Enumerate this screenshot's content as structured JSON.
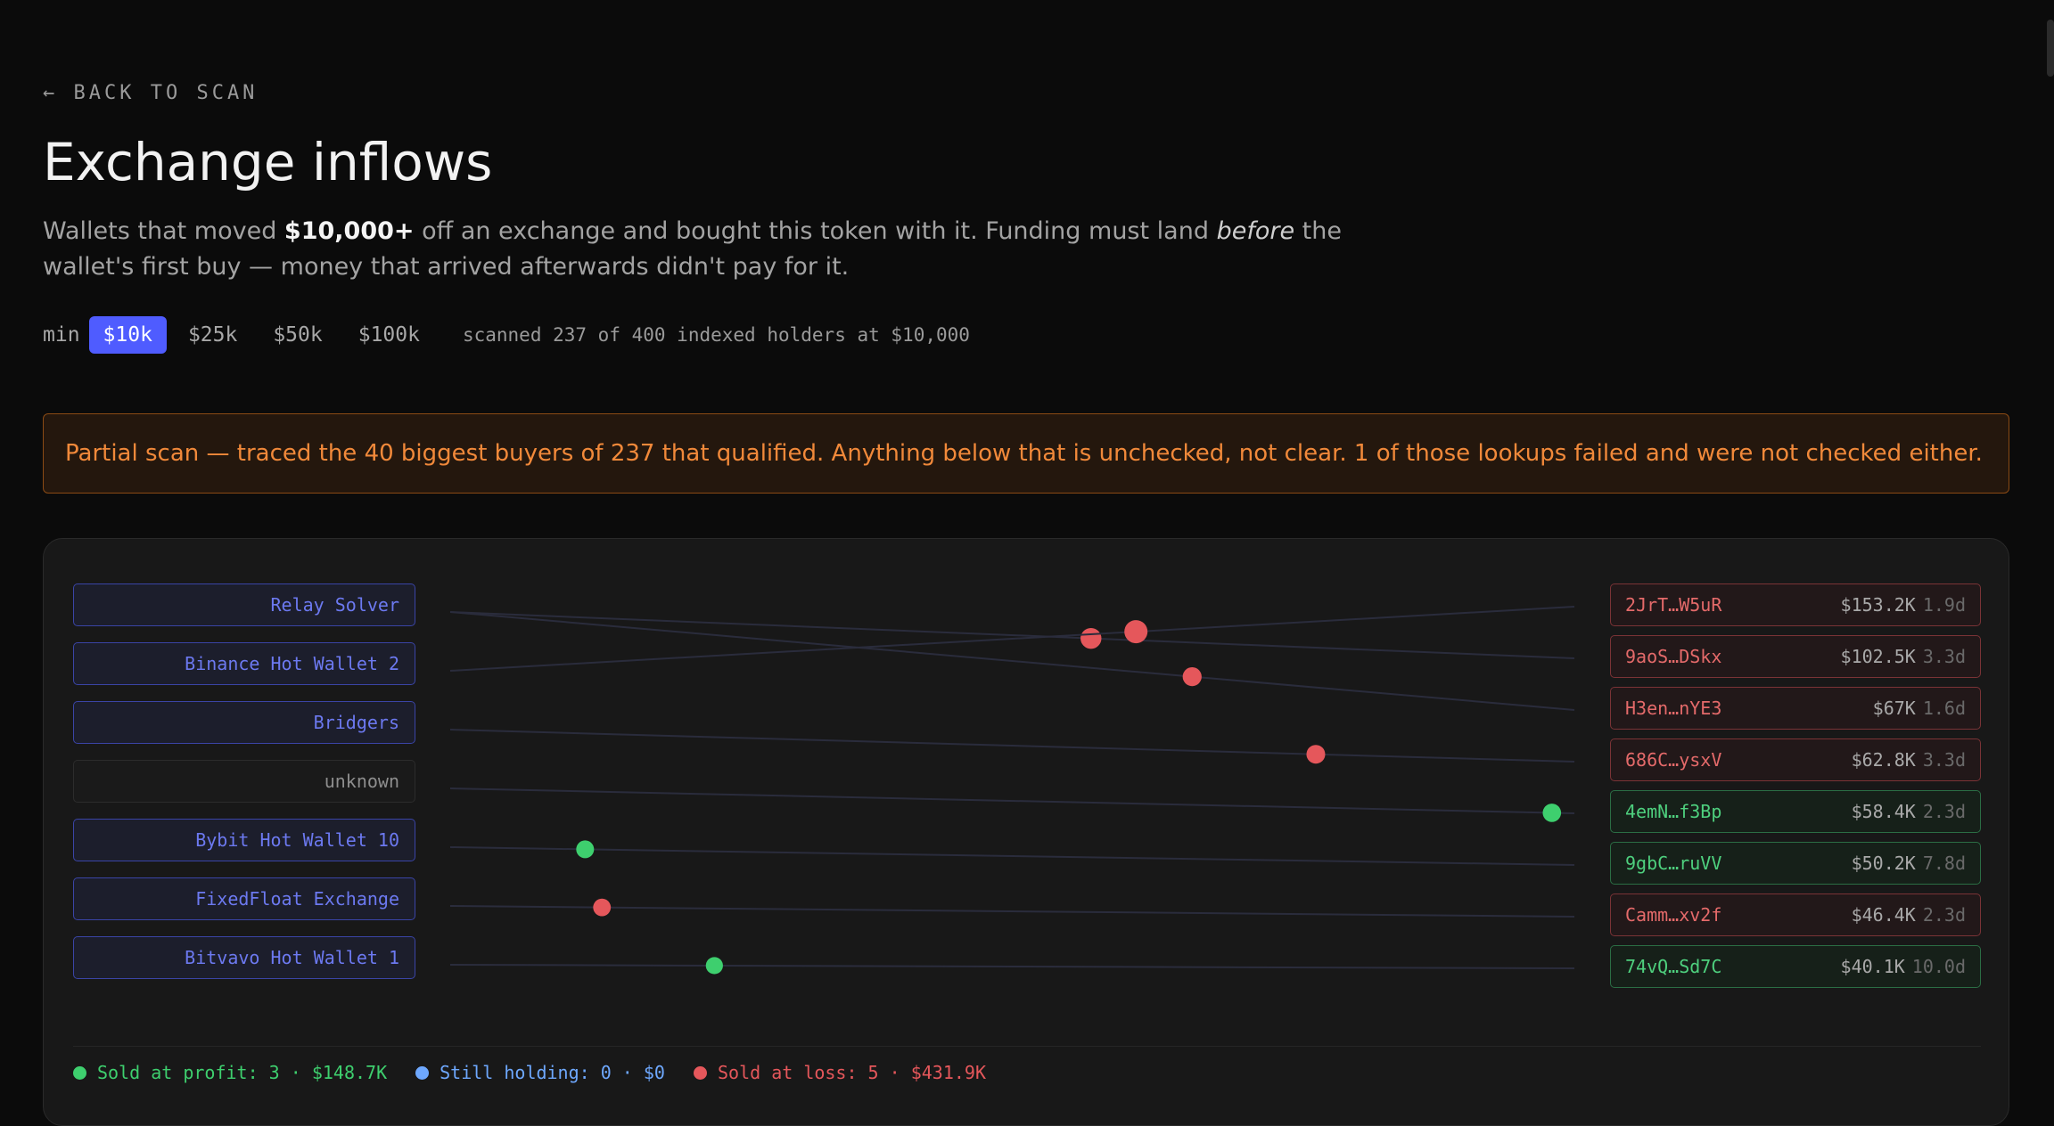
{
  "nav": {
    "back_label": "← BACK TO SCAN"
  },
  "page": {
    "title": "Exchange inflows",
    "desc_1": "Wallets that moved ",
    "desc_bold": "$10,000+",
    "desc_2": " off an exchange and bought this token with it. Funding must land ",
    "desc_italic": "before",
    "desc_3": " the wallet's first buy — money that arrived afterwards didn't pay for it."
  },
  "filters": {
    "label": "min",
    "options": [
      "$10k",
      "$25k",
      "$50k",
      "$100k"
    ],
    "active": "$10k",
    "scan_info": "scanned 237 of 400 indexed holders at $10,000"
  },
  "banner": {
    "text": "Partial scan — traced the 40 biggest buyers of 237 that qualified. Anything below that is unchecked, not clear. 1 of those lookups failed and were not checked either."
  },
  "sources": [
    {
      "label": "Relay Solver",
      "known": true
    },
    {
      "label": "Binance Hot Wallet 2",
      "known": true
    },
    {
      "label": "Bridgers",
      "known": true
    },
    {
      "label": "unknown",
      "known": false
    },
    {
      "label": "Bybit Hot Wallet 10",
      "known": true
    },
    {
      "label": "FixedFloat Exchange",
      "known": true
    },
    {
      "label": "Bitvavo Hot Wallet 1",
      "known": true
    }
  ],
  "wallets": [
    {
      "address": "2JrT…W5uR",
      "amount": "$153.2K",
      "age": "1.9d",
      "outcome": "loss"
    },
    {
      "address": "9aoS…DSkx",
      "amount": "$102.5K",
      "age": "3.3d",
      "outcome": "loss"
    },
    {
      "address": "H3en…nYE3",
      "amount": "$67K",
      "age": "1.6d",
      "outcome": "loss"
    },
    {
      "address": "686C…ysxV",
      "amount": "$62.8K",
      "age": "3.3d",
      "outcome": "loss"
    },
    {
      "address": "4emN…f3Bp",
      "amount": "$58.4K",
      "age": "2.3d",
      "outcome": "profit"
    },
    {
      "address": "9gbC…ruVV",
      "amount": "$50.2K",
      "age": "7.8d",
      "outcome": "profit"
    },
    {
      "address": "Camm…xv2f",
      "amount": "$46.4K",
      "age": "2.3d",
      "outcome": "loss"
    },
    {
      "address": "74vQ…Sd7C",
      "amount": "$40.1K",
      "age": "10.0d",
      "outcome": "profit"
    }
  ],
  "flows": [
    {
      "from": 0,
      "to": 1,
      "progress": 0.57
    },
    {
      "from": 1,
      "to": 0,
      "progress": 0.61
    },
    {
      "from": 0,
      "to": 2,
      "progress": 0.66
    },
    {
      "from": 2,
      "to": 3,
      "progress": 0.77
    },
    {
      "from": 3,
      "to": 4,
      "progress": 0.98
    },
    {
      "from": 4,
      "to": 5,
      "progress": 0.12
    },
    {
      "from": 5,
      "to": 6,
      "progress": 0.135
    },
    {
      "from": 6,
      "to": 7,
      "progress": 0.235
    }
  ],
  "legend": {
    "profit": "Sold at profit: 3 · $148.7K",
    "holding": "Still holding: 0 · $0",
    "loss": "Sold at loss: 5 · $431.9K"
  },
  "colors": {
    "accent": "#4f5cff",
    "profit": "#3ecf6e",
    "holding": "#6ea8fe",
    "loss": "#e5575b",
    "warning": "#f1893a"
  }
}
